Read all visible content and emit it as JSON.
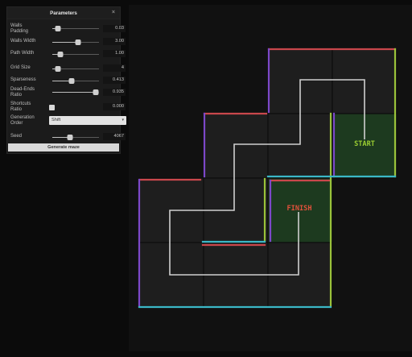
{
  "panel": {
    "title": "Parameters",
    "close_glyph": "×",
    "rows": [
      {
        "label": "Walls\nPadding",
        "value": "0.03",
        "level": 0.12
      },
      {
        "label": "Walls Width",
        "value": "3.00",
        "level": 0.55
      },
      {
        "label": "Path Width",
        "value": "1.00",
        "level": 0.18
      },
      {
        "label": "Grid Size",
        "value": "4",
        "level": 0.12
      },
      {
        "label": "Sparseness",
        "value": "0.413",
        "level": 0.41
      },
      {
        "label": "Dead-Ends\nRatio",
        "value": "0.935",
        "level": 0.93
      },
      {
        "label": "Shortcuts\nRatio",
        "value": "0.000",
        "checked": false
      },
      {
        "label": "Generation\nOrder",
        "value": "Shift",
        "type": "select"
      },
      {
        "label": "Seed",
        "value": "4067",
        "level": 0.38
      }
    ],
    "generate_label": "Generate maze"
  },
  "maze": {
    "start_label": "START",
    "finish_label": "FINISH",
    "colors": {
      "wall_red": "#c9474c",
      "wall_purple": "#7c48c9",
      "wall_green": "#9ac23a",
      "wall_cyan": "#3bb7c6",
      "path": "#cfcfcf",
      "cell": "#1e1e1e",
      "cell_grid": "#0d0d0d",
      "start_cell": "#1d3a1f",
      "finish_cell": "#1d3a1f",
      "start_text": "#9acd32",
      "finish_text": "#e0513b"
    }
  }
}
